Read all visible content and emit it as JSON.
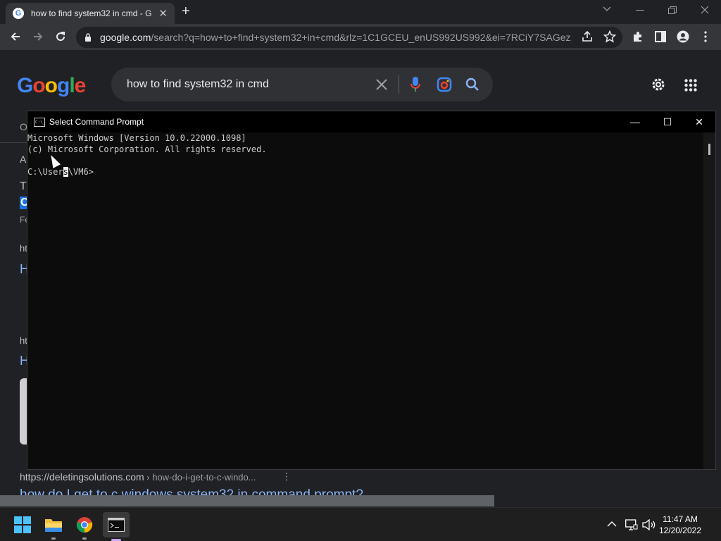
{
  "browser": {
    "tab_title": "how to find system32 in cmd - G",
    "tab_favicon": "G",
    "tab_close": "✕",
    "new_tab": "+",
    "url_host": "google.com",
    "url_rest": "/search?q=how+to+find+system32+in+cmd&rlz=1C1GCEU_enUS992US992&ei=7RCiY7SAGez..."
  },
  "google": {
    "logo_letters": [
      "G",
      "o",
      "o",
      "g",
      "l",
      "e"
    ],
    "logo_colors": [
      "#4285f4",
      "#ea4335",
      "#fbbc05",
      "#4285f4",
      "#34a853",
      "#ea4335"
    ],
    "query": "how to find system32 in cmd",
    "bg_snippets": [
      "O",
      "A",
      "T",
      "C",
      "Fe",
      "ht",
      "H",
      "ht",
      "H"
    ],
    "result_url": "https://deletingsolutions.com",
    "result_path": " › how-do-i-get-to-c-windo...",
    "result_more": "⋮",
    "result_title": "how do I get to c windows system32 in command prompt?"
  },
  "cmd": {
    "title": "Select Command Prompt",
    "icon_text": "C:\\_",
    "line1": "Microsoft Windows [Version 10.0.22000.1098]",
    "line2": "(c) Microsoft Corporation. All rights reserved.",
    "prompt_before": "C:\\User",
    "prompt_selected": "s",
    "prompt_after": "\\VM6>",
    "minimize": "—",
    "maximize": "☐",
    "close": "✕"
  },
  "taskbar": {
    "time": "11:47 AM",
    "date": "12/20/2022"
  }
}
